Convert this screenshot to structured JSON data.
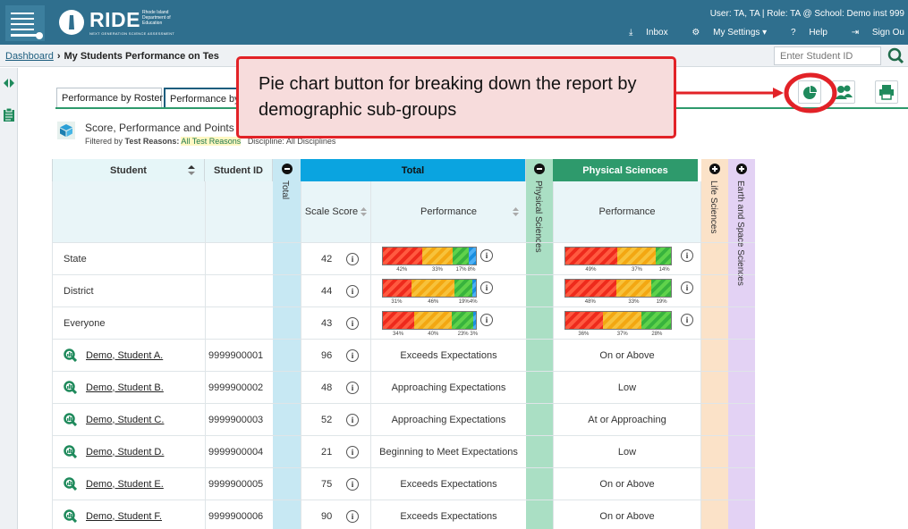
{
  "banner": {
    "logo_word": "RIDE",
    "logo_sub": "Rhode Island Department of Education",
    "logo_tag": "NEXT GENERATION SCIENCE ASSESSMENT",
    "user_info": "User: TA, TA  |  Role: TA @ School: Demo inst 999",
    "links": {
      "inbox": "Inbox",
      "settings": "My Settings ▾",
      "help": "Help",
      "signout": "Sign Ou"
    }
  },
  "breadcrumb": {
    "home": "Dashboard",
    "current": "My Students Performance on Tes"
  },
  "student_search": {
    "placeholder": "Enter Student ID"
  },
  "tabs": [
    {
      "label": "Performance by Roster"
    },
    {
      "label": "Performance by"
    }
  ],
  "callout": {
    "text": "Pie chart button for breaking down the report by demographic sub-groups"
  },
  "report": {
    "title": "Score, Performance and Points Ea",
    "filter_prefix": "Filtered by",
    "filter_key": "Test Reasons:",
    "filter_value": "All Test Reasons",
    "filter_extra": "Discipline: All Disciplines"
  },
  "columns": {
    "student": "Student",
    "student_id": "Student ID",
    "total": "Total",
    "physical_sciences": "Physical Sciences",
    "life_sciences": "Life Sciences",
    "earth_space": "Earth and Space Sciences",
    "scale_score": "Scale Score",
    "performance": "Performance"
  },
  "aggregate_rows": [
    {
      "name": "State",
      "score": "42",
      "total_bar": [
        42,
        33,
        17,
        8
      ],
      "total_labels": [
        "42%",
        "33%",
        "17%",
        "8%"
      ],
      "phys_bar": [
        49,
        37,
        14
      ],
      "phys_labels": [
        "49%",
        "37%",
        "14%"
      ]
    },
    {
      "name": "District",
      "score": "44",
      "total_bar": [
        31,
        46,
        19,
        4
      ],
      "total_labels": [
        "31%",
        "46%",
        "19%",
        "4%"
      ],
      "phys_bar": [
        48,
        33,
        19
      ],
      "phys_labels": [
        "48%",
        "33%",
        "19%"
      ]
    },
    {
      "name": "Everyone",
      "score": "43",
      "total_bar": [
        34,
        40,
        23,
        3
      ],
      "total_labels": [
        "34%",
        "40%",
        "23%",
        "3%"
      ],
      "phys_bar": [
        36,
        37,
        28
      ],
      "phys_labels": [
        "36%",
        "37%",
        "28%"
      ]
    }
  ],
  "student_rows": [
    {
      "name": "Demo, Student A.",
      "id": "9999900001",
      "score": "96",
      "performance": "Exceeds Expectations",
      "physical": "On or Above"
    },
    {
      "name": "Demo, Student B.",
      "id": "9999900002",
      "score": "48",
      "performance": "Approaching Expectations",
      "physical": "Low"
    },
    {
      "name": "Demo, Student C.",
      "id": "9999900003",
      "score": "52",
      "performance": "Approaching Expectations",
      "physical": "At or Approaching"
    },
    {
      "name": "Demo, Student D.",
      "id": "9999900004",
      "score": "21",
      "performance": "Beginning to Meet Expectations",
      "physical": "Low"
    },
    {
      "name": "Demo, Student E.",
      "id": "9999900005",
      "score": "75",
      "performance": "Exceeds Expectations",
      "physical": "On or Above"
    },
    {
      "name": "Demo, Student F.",
      "id": "9999900006",
      "score": "90",
      "performance": "Exceeds Expectations",
      "physical": "On or Above"
    }
  ],
  "colors": {
    "banner": "#2f6f8e",
    "total_header": "#0aa4e0",
    "physical_header": "#2e9a6c",
    "callout_border": "#e22227",
    "callout_fill": "#f7dcdc"
  },
  "icons": [
    "grid-menu-icon",
    "ride-logo",
    "inbox-icon",
    "settings-gear-icon",
    "help-icon",
    "sign-out-icon",
    "search-icon",
    "collapse-toggle-icon",
    "clipboard-icon",
    "pie-chart-icon",
    "group-icon",
    "print-icon",
    "report-cube-icon",
    "sort-icon",
    "info-icon",
    "student-portfolio-icon",
    "expand-toggle-icon"
  ]
}
